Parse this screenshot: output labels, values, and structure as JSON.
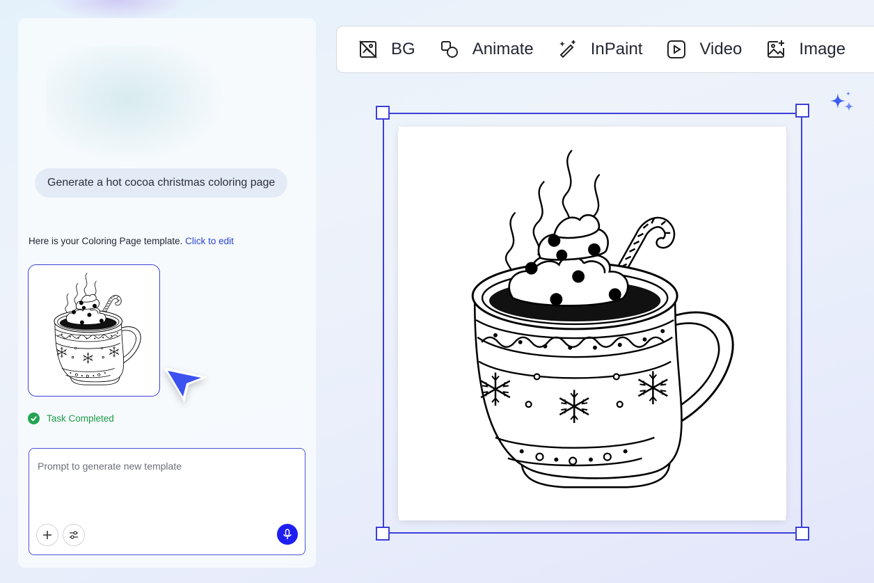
{
  "chat": {
    "user_message": "Generate a hot cocoa christmas coloring page",
    "reply_text": "Here is your Coloring Page template.",
    "reply_link": "Click to edit",
    "status": "Task Completed"
  },
  "prompt": {
    "placeholder": "Prompt to generate new template"
  },
  "toolbar": {
    "tools": [
      {
        "label": "BG",
        "icon": "bg-remove-icon"
      },
      {
        "label": "Animate",
        "icon": "animate-icon"
      },
      {
        "label": "InPaint",
        "icon": "magic-wand-icon"
      },
      {
        "label": "Video",
        "icon": "video-icon"
      },
      {
        "label": "Image",
        "icon": "image-add-icon"
      }
    ]
  },
  "colors": {
    "accent": "#3b3fd8",
    "success": "#22a452",
    "mic": "#1f1ff2"
  }
}
